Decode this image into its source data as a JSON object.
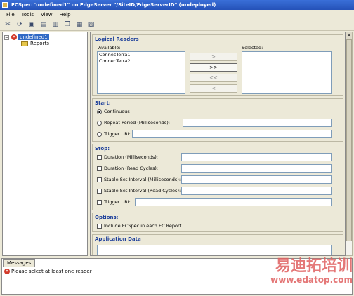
{
  "window": {
    "title": "ECSpec \"undefined1\" on EdgeServer \"/SiteID/EdgeServerID\" (undeployed)"
  },
  "menu": [
    "File",
    "Tools",
    "View",
    "Help"
  ],
  "toolbar": {
    "icons": [
      "cut-icon",
      "refresh-icon",
      "deploy-icon",
      "open-icon",
      "save-icon",
      "copy-icon",
      "paste-icon",
      "properties-icon"
    ]
  },
  "tree": {
    "root": "undefined1",
    "child": "Reports"
  },
  "logical_readers": {
    "title": "Logical Readers",
    "available_label": "Available:",
    "selected_label": "Selected:",
    "available": [
      "ConnecTerra1",
      "ConnecTerra2"
    ],
    "buttons": [
      ">",
      ">>",
      "<<",
      "<"
    ]
  },
  "start": {
    "title": "Start:",
    "continuous": "Continuous",
    "repeat_period": "Repeat Period (Milliseconds):",
    "trigger_uri": "Trigger URI:",
    "selected": "continuous"
  },
  "stop": {
    "title": "Stop:",
    "duration_ms": "Duration (Milliseconds):",
    "duration_cycles": "Duration (Read Cycles):",
    "stable_ms": "Stable Set Interval (Milliseconds):",
    "stable_cycles": "Stable Set Interval (Read Cycles):",
    "trigger_uri": "Trigger URI:"
  },
  "options": {
    "title": "Options:",
    "include_ecspec": "Include ECSpec in each EC Report"
  },
  "application_data": {
    "title": "Application Data"
  },
  "messages": {
    "tab": "Messages",
    "line": "Please select at least one reader"
  },
  "watermark": {
    "cn": "易迪拓培训",
    "url": "www.edatop.com"
  }
}
